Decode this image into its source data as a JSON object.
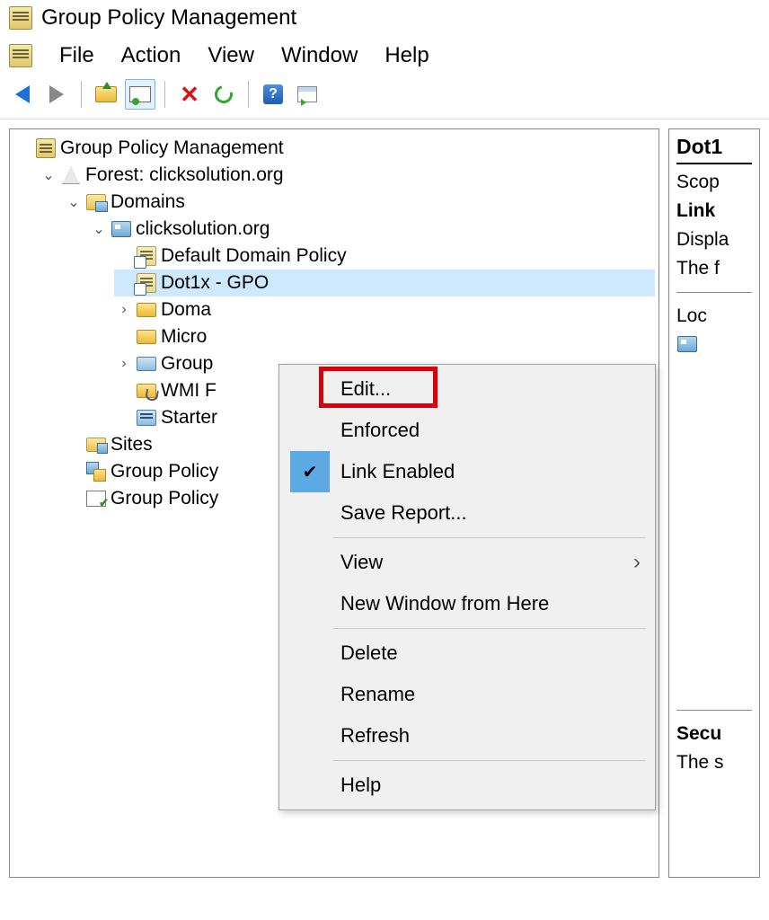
{
  "window": {
    "title": "Group Policy Management"
  },
  "menu": {
    "file": "File",
    "action": "Action",
    "view": "View",
    "window": "Window",
    "help": "Help"
  },
  "tree": {
    "root": "Group Policy Management",
    "forest": "Forest: clicksolution.org",
    "domains": "Domains",
    "domain": "clicksolution.org",
    "default_policy": "Default Domain Policy",
    "dot1x": "Dot1x - GPO",
    "domain_controllers": "Doma",
    "microsoft": "Micro",
    "gpo_container": "Group",
    "wmi": "WMI F",
    "starter": "Starter",
    "sites": "Sites",
    "modeling": "Group Policy",
    "results": "Group Policy"
  },
  "context_menu": {
    "edit": "Edit...",
    "enforced": "Enforced",
    "link_enabled": "Link Enabled",
    "save_report": "Save Report...",
    "view": "View",
    "new_window": "New Window from Here",
    "delete": "Delete",
    "rename": "Rename",
    "refresh": "Refresh",
    "help": "Help"
  },
  "right": {
    "title": "Dot1",
    "scope": "Scop",
    "links": "Link",
    "display": "Displa",
    "the_following": "The f",
    "location": "Loc",
    "security": "Secu",
    "the_s": "The s"
  }
}
